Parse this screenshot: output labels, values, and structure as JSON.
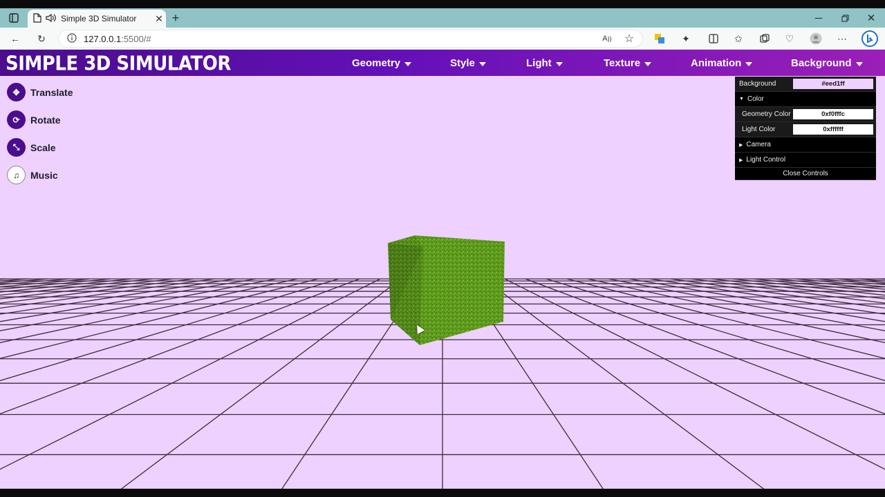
{
  "browser": {
    "tab_title": "Simple 3D Simulator",
    "url_host": "127.0.0.1",
    "url_rest": ":5500/#"
  },
  "app": {
    "logo": "SIMPLE 3D SIMULATOR",
    "background_color": "#eed1ff",
    "nav": [
      "Geometry",
      "Style",
      "Light",
      "Texture",
      "Animation",
      "Background"
    ],
    "tools": [
      {
        "label": "Translate",
        "icon": "move-icon"
      },
      {
        "label": "Rotate",
        "icon": "rotate-icon"
      },
      {
        "label": "Scale",
        "icon": "scale-icon"
      },
      {
        "label": "Music",
        "icon": "music-icon"
      }
    ]
  },
  "controls": {
    "background_label": "Background",
    "background_value": "#eed1ff",
    "color_folder": "Color",
    "geometry_color_label": "Geometry Color",
    "geometry_color_value": "0xf0fffc",
    "light_color_label": "Light Color",
    "light_color_value": "0xffffff",
    "camera_folder": "Camera",
    "light_control_folder": "Light Control",
    "close_label": "Close Controls"
  }
}
